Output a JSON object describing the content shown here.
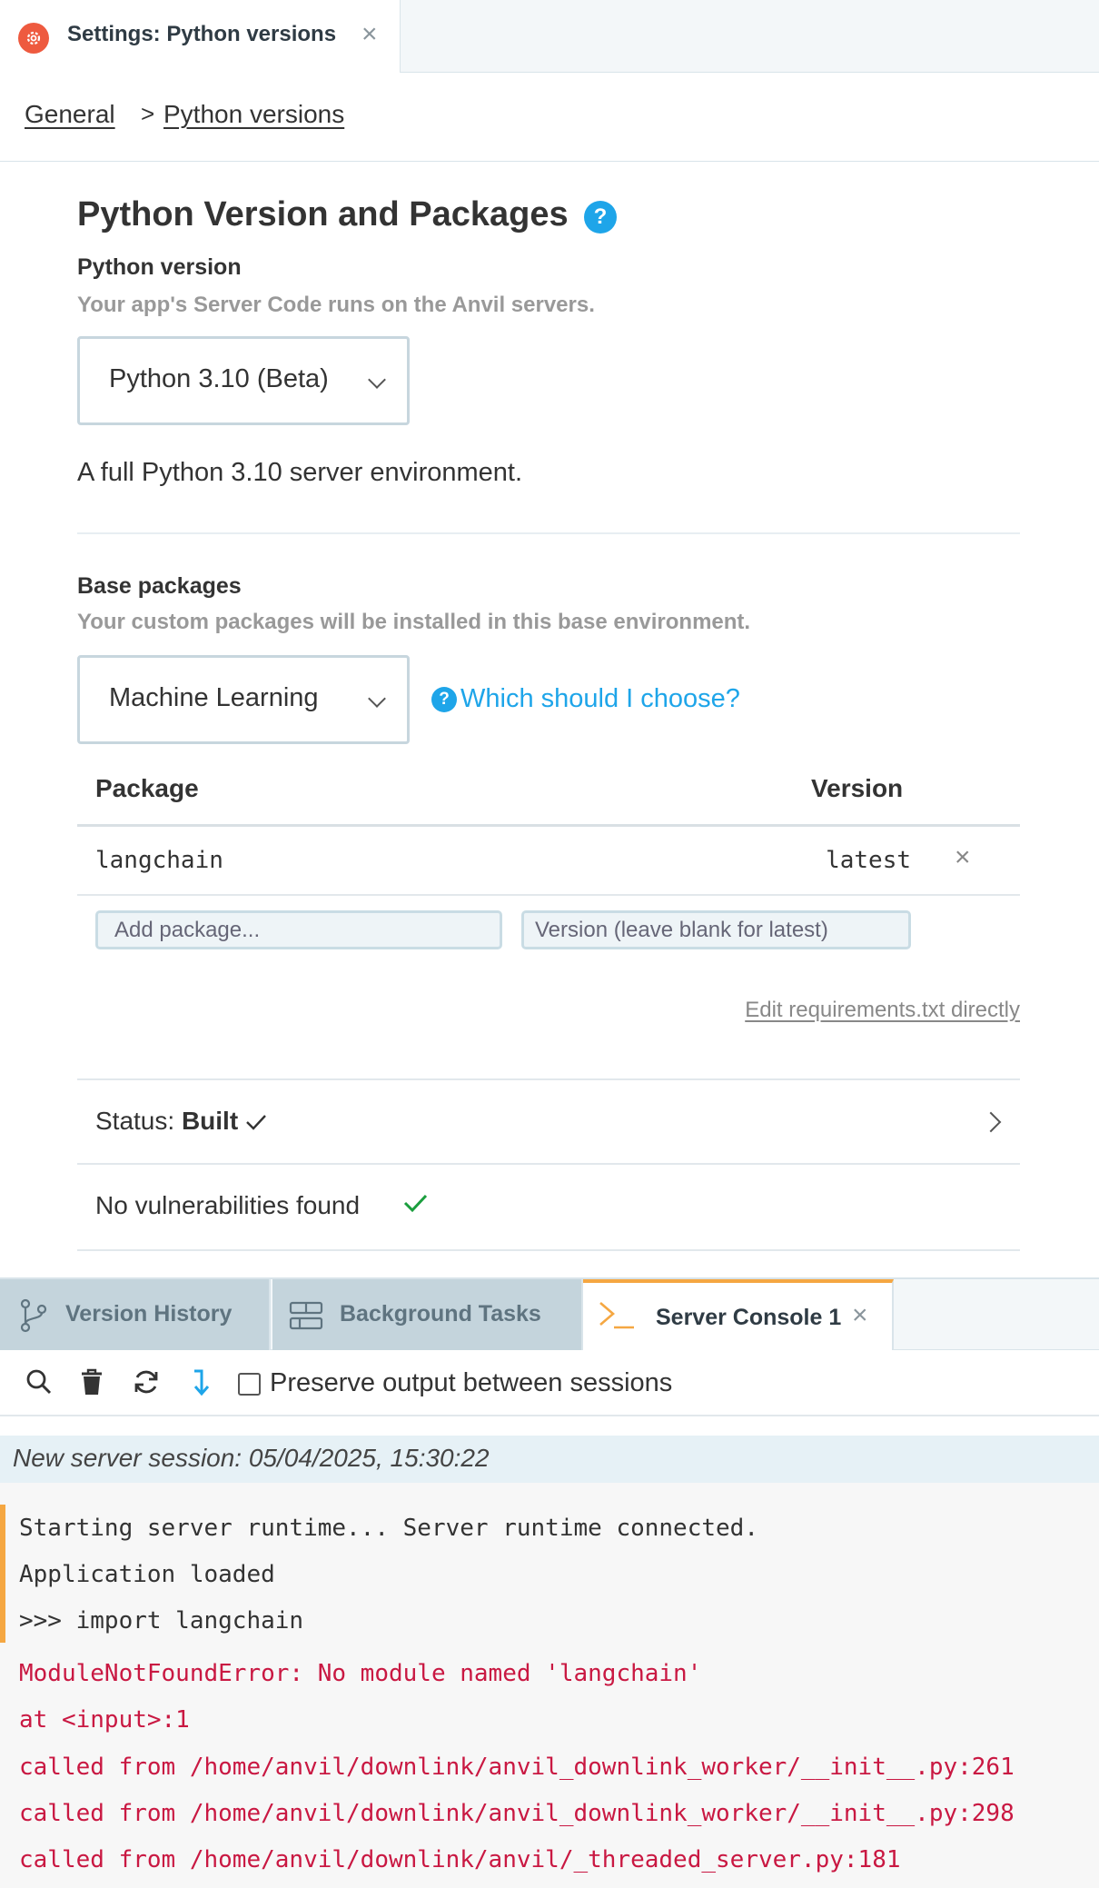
{
  "top_tab": {
    "label": "Settings: Python versions",
    "close": "×"
  },
  "breadcrumb": {
    "items": [
      "General",
      "Python versions"
    ],
    "separator": ">"
  },
  "section": {
    "title": "Python Version and Packages",
    "help": "?",
    "python_version_label": "Python version",
    "python_version_desc": "Your app's Server Code runs on the Anvil servers.",
    "python_version_value": "Python 3.10 (Beta)",
    "env_desc": "A full Python 3.10 server environment.",
    "base_packages_label": "Base packages",
    "base_packages_desc": "Your custom packages will be installed in this base environment.",
    "base_packages_value": "Machine Learning",
    "choose_link": "Which should I choose?"
  },
  "packages": {
    "col_package": "Package",
    "col_version": "Version",
    "rows": [
      {
        "name": "langchain",
        "version": "latest"
      }
    ],
    "add_package_placeholder": "Add package...",
    "version_placeholder": "Version (leave blank for latest)",
    "edit_requirements": "Edit requirements.txt directly"
  },
  "status": {
    "prefix": "Status:",
    "value": "Built"
  },
  "vulnerabilities": "No vulnerabilities found",
  "bottom_tabs": [
    {
      "label": "Version History"
    },
    {
      "label": "Background Tasks"
    },
    {
      "label": "Server Console 1",
      "active": true
    }
  ],
  "console": {
    "preserve_label": "Preserve output between sessions",
    "session": "New server session: 05/04/2025, 15:30:22",
    "output": [
      "Starting server runtime... Server runtime connected.",
      "Application loaded",
      ">>> import langchain"
    ],
    "errors": [
      "ModuleNotFoundError: No module named 'langchain'",
      "at <input>:1",
      "called from /home/anvil/downlink/anvil_downlink_worker/__init__.py:261",
      "called from /home/anvil/downlink/anvil_downlink_worker/__init__.py:298",
      "called from /home/anvil/downlink/anvil/_threaded_server.py:181"
    ]
  },
  "colors": {
    "accent_blue": "#1ea5e9",
    "brand_orange": "#ee5a3f",
    "tab_active": "#f5a742",
    "success": "#1b9e3e",
    "error": "#c91842"
  },
  "icons": [
    "gear-icon",
    "close-icon",
    "help-icon",
    "chevron-down-icon",
    "chevron-right-icon",
    "check-icon",
    "branch-icon",
    "tasks-icon",
    "terminal-icon",
    "search-icon",
    "trash-icon",
    "refresh-icon",
    "scroll-down-icon"
  ]
}
